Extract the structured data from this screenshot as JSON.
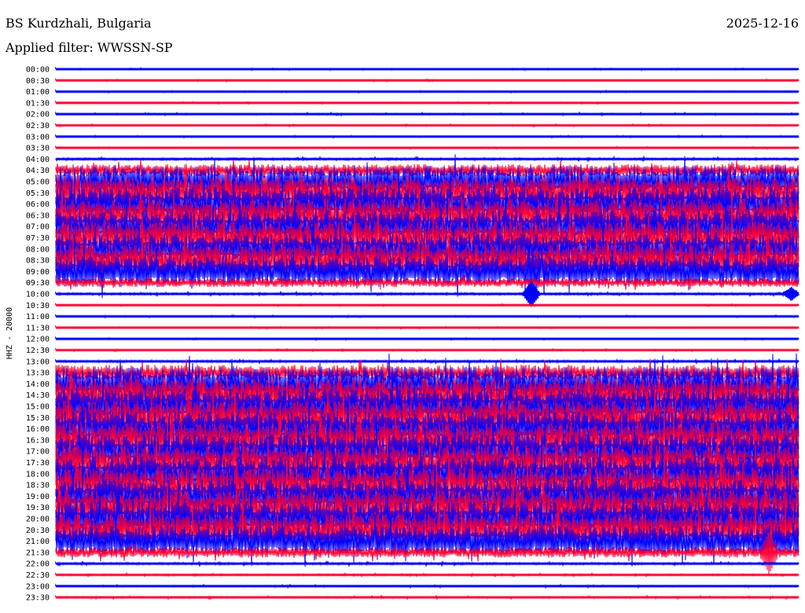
{
  "header": {
    "station": "BS Kurdzhali, Bulgaria",
    "filter": "Applied filter: WWSSN-SP",
    "date": "2025-12-16"
  },
  "chart_data": {
    "type": "helicorder",
    "channel_label": "HHZ - 20000",
    "colors": {
      "odd": "#0000ff",
      "even": "#ff0033"
    },
    "rows": [
      {
        "label": "00:00",
        "level": 0.03
      },
      {
        "label": "00:30",
        "level": 0.03
      },
      {
        "label": "01:00",
        "level": 0.03
      },
      {
        "label": "01:30",
        "level": 0.03
      },
      {
        "label": "02:00",
        "level": 0.04
      },
      {
        "label": "02:30",
        "level": 0.03
      },
      {
        "label": "03:00",
        "level": 0.03
      },
      {
        "label": "03:30",
        "level": 0.03
      },
      {
        "label": "04:00",
        "level": 0.05
      },
      {
        "label": "04:30",
        "level": 0.35
      },
      {
        "label": "05:00",
        "level": 0.9
      },
      {
        "label": "05:30",
        "level": 0.95
      },
      {
        "label": "06:00",
        "level": 0.95
      },
      {
        "label": "06:30",
        "level": 0.95
      },
      {
        "label": "07:00",
        "level": 0.95
      },
      {
        "label": "07:30",
        "level": 0.95
      },
      {
        "label": "08:00",
        "level": 0.9
      },
      {
        "label": "08:30",
        "level": 0.95
      },
      {
        "label": "09:00",
        "level": 0.9
      },
      {
        "label": "09:30",
        "level": 0.25
      },
      {
        "label": "10:00",
        "level": 0.05
      },
      {
        "label": "10:30",
        "level": 0.03
      },
      {
        "label": "11:00",
        "level": 0.03
      },
      {
        "label": "11:30",
        "level": 0.03
      },
      {
        "label": "12:00",
        "level": 0.03
      },
      {
        "label": "12:30",
        "level": 0.03
      },
      {
        "label": "13:00",
        "level": 0.05
      },
      {
        "label": "13:30",
        "level": 0.45
      },
      {
        "label": "14:00",
        "level": 1.0
      },
      {
        "label": "14:30",
        "level": 1.0
      },
      {
        "label": "15:00",
        "level": 1.0
      },
      {
        "label": "15:30",
        "level": 1.0
      },
      {
        "label": "16:00",
        "level": 1.0
      },
      {
        "label": "16:30",
        "level": 1.0
      },
      {
        "label": "17:00",
        "level": 1.0
      },
      {
        "label": "17:30",
        "level": 1.0
      },
      {
        "label": "18:00",
        "level": 1.0
      },
      {
        "label": "18:30",
        "level": 1.0
      },
      {
        "label": "19:00",
        "level": 1.0
      },
      {
        "label": "19:30",
        "level": 1.0
      },
      {
        "label": "20:00",
        "level": 1.0
      },
      {
        "label": "20:30",
        "level": 0.95
      },
      {
        "label": "21:00",
        "level": 0.9
      },
      {
        "label": "21:30",
        "level": 0.3
      },
      {
        "label": "22:00",
        "level": 0.05
      },
      {
        "label": "22:30",
        "level": 0.04
      },
      {
        "label": "23:00",
        "level": 0.04
      },
      {
        "label": "23:30",
        "level": 0.04
      }
    ],
    "events": [
      {
        "row": "10:00",
        "at": 0.64,
        "amp": 2.0
      },
      {
        "row": "10:00",
        "at": 0.99,
        "amp": 1.0
      },
      {
        "row": "09:00",
        "at": 0.64,
        "amp": 1.5
      },
      {
        "row": "21:30",
        "at": 0.96,
        "amp": 3.0
      }
    ]
  }
}
